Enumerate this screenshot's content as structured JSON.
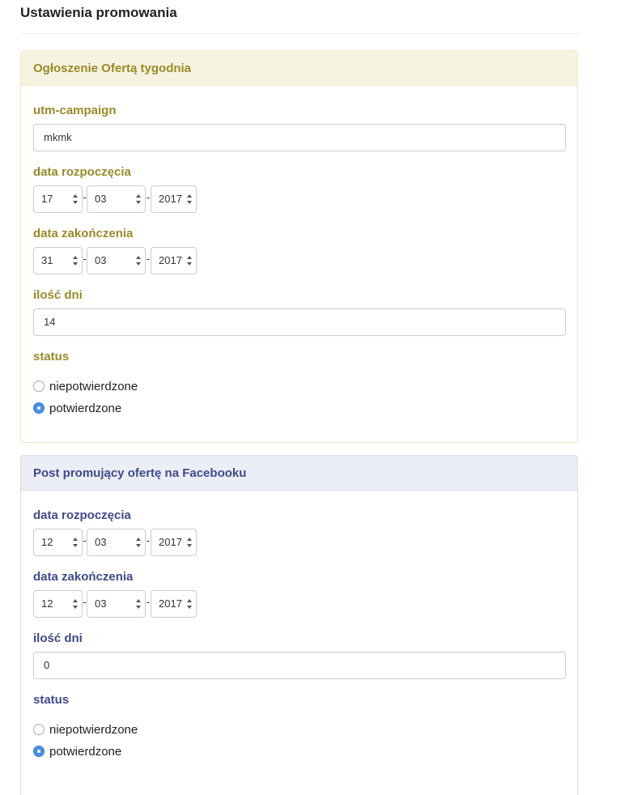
{
  "page_title": "Ustawienia promowania",
  "panels": [
    {
      "heading": "Ogłoszenie Ofertą tygodnia",
      "utm_label": "utm-campaign",
      "utm_value": "mkmk",
      "start_label": "data rozpoczęcia",
      "start": {
        "day": "17",
        "month": "03",
        "year": "2017"
      },
      "end_label": "data zakończenia",
      "end": {
        "day": "31",
        "month": "03",
        "year": "2017"
      },
      "days_label": "ilość dni",
      "days_value": "14",
      "status_label": "status",
      "options": [
        {
          "label": "niepotwierdzone",
          "checked": false
        },
        {
          "label": "potwierdzone",
          "checked": true
        }
      ]
    },
    {
      "heading": "Post promujący ofertę na Facebooku",
      "start_label": "data rozpoczęcia",
      "start": {
        "day": "12",
        "month": "03",
        "year": "2017"
      },
      "end_label": "data zakończenia",
      "end": {
        "day": "12",
        "month": "03",
        "year": "2017"
      },
      "days_label": "ilość dni",
      "days_value": "0",
      "status_label": "status",
      "options": [
        {
          "label": "niepotwierdzone",
          "checked": false
        },
        {
          "label": "potwierdzone",
          "checked": true
        }
      ]
    }
  ],
  "separator": "-",
  "colors": {
    "panel1_accent": "#9a8a2a",
    "panel2_accent": "#3f4a8a",
    "radio_checked": "#4a90e2"
  }
}
